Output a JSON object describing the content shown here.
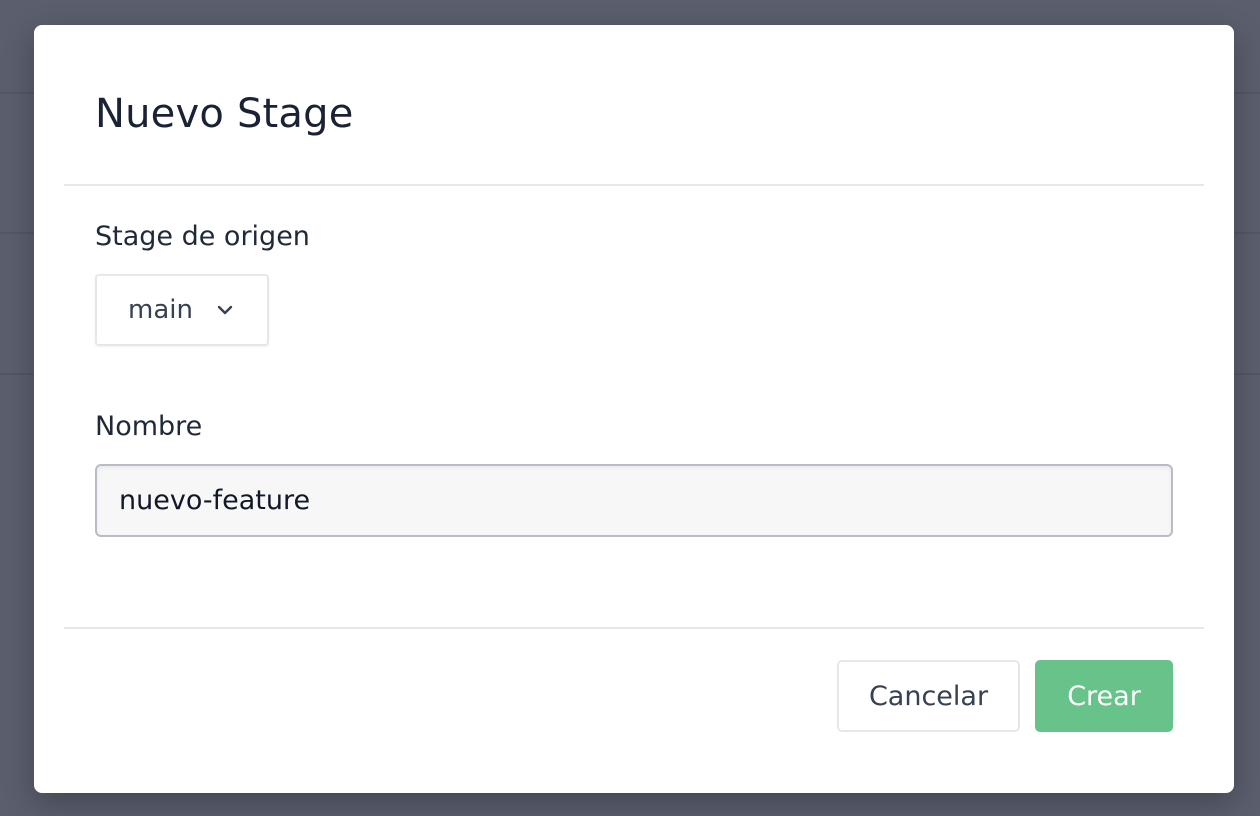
{
  "dialog": {
    "title": "Nuevo Stage",
    "origin_label": "Stage de origen",
    "origin_value": "main",
    "name_label": "Nombre",
    "name_value": "nuevo-feature",
    "cancel_label": "Cancelar",
    "create_label": "Crear"
  },
  "icons": {
    "chevron": "chevron-down-icon"
  },
  "colors": {
    "overlay": "#5a5e6d",
    "primary": "#68c38a",
    "title": "#1a2233"
  }
}
